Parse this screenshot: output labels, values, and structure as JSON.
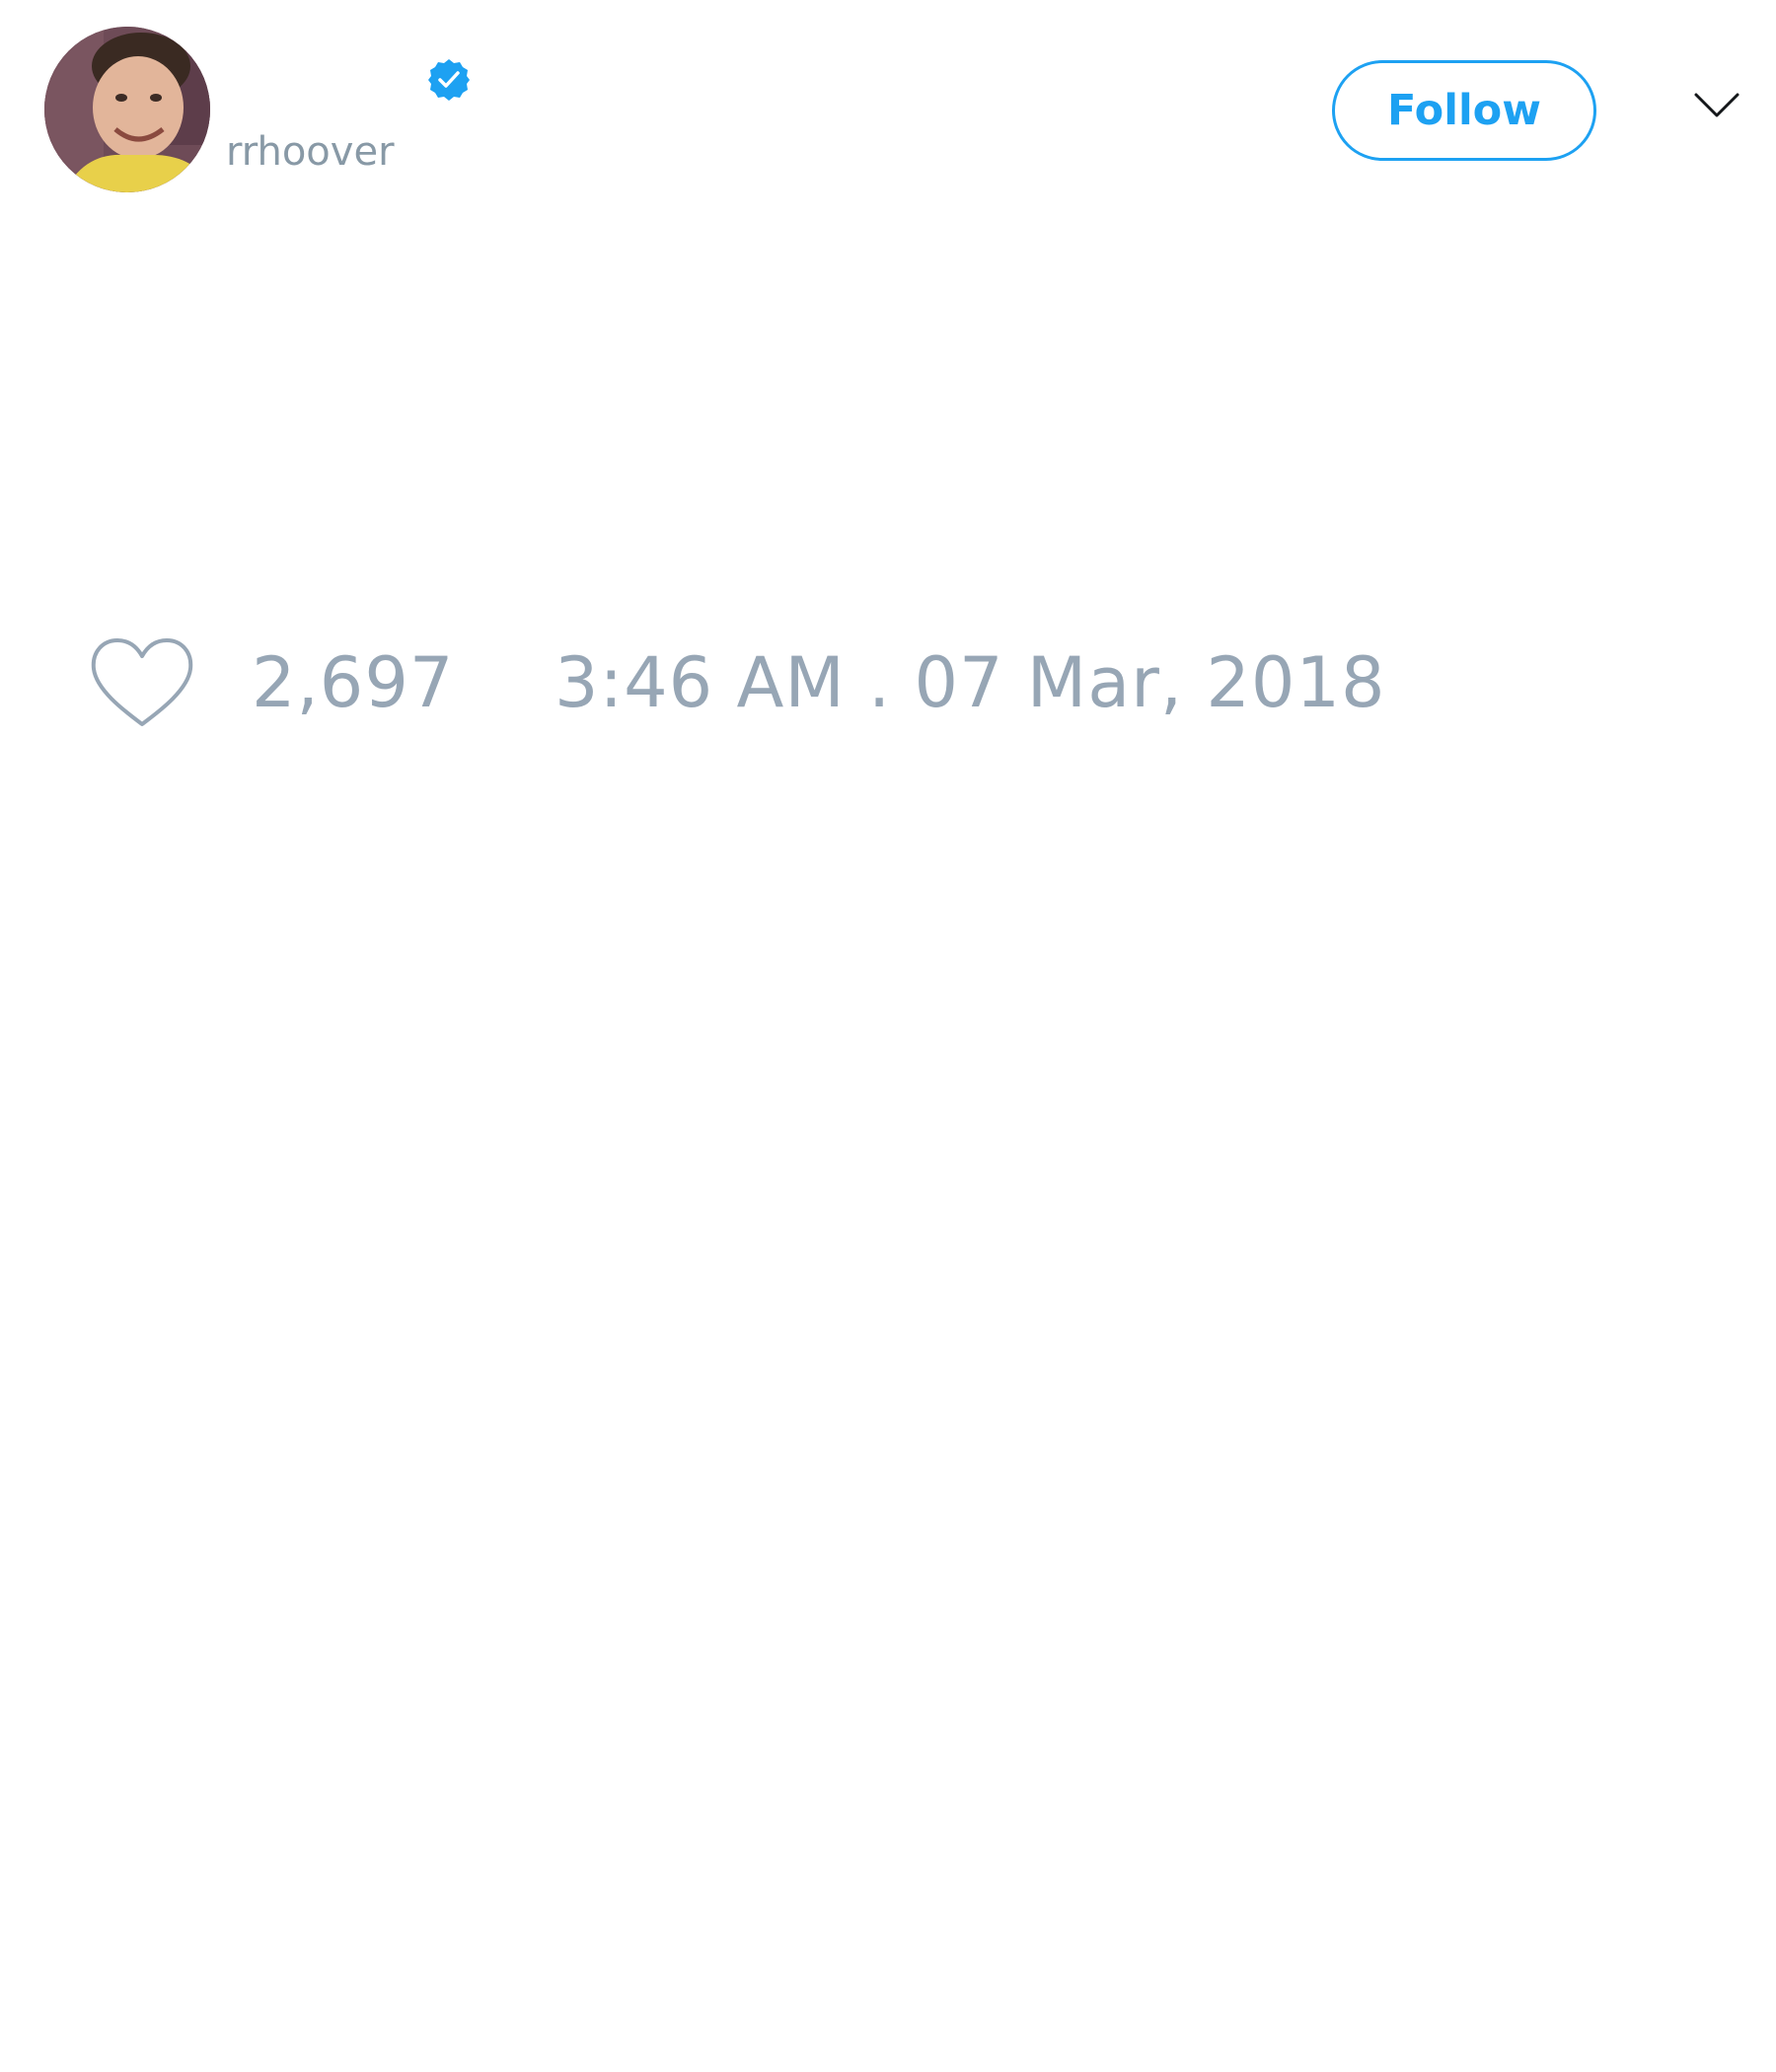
{
  "tweet": {
    "author": {
      "username": "rrhoover",
      "avatar": "avatar-photo",
      "verified_icon": "verified-badge-icon"
    },
    "follow_label": "Follow",
    "menu_icon": "chevron-down-icon",
    "likes": {
      "icon": "heart-icon",
      "count": "2,697"
    },
    "timestamp": "3:46 AM . 07 Mar, 2018"
  },
  "colors": {
    "accent": "#1da1f2",
    "muted_text": "#8899a6",
    "background": "#ffffff"
  }
}
